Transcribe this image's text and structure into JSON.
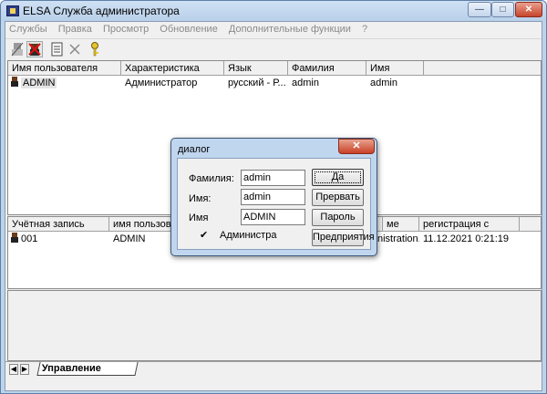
{
  "window": {
    "title": "ELSA Служба администратора",
    "min": "—",
    "max": "□",
    "close": "✕"
  },
  "menu": [
    "Службы",
    "Правка",
    "Просмотр",
    "Обновление",
    "Дополнительные функции",
    "?"
  ],
  "toolbar": {
    "icons": [
      "users-icon",
      "delete-user-icon",
      "properties-icon",
      "close-icon",
      "key-icon"
    ]
  },
  "top_table": {
    "columns": [
      "Имя пользователя",
      "Характеристика",
      "Язык",
      "Фамилия",
      "Имя"
    ],
    "rows": [
      {
        "user": "ADMIN",
        "characteristic": "Администратор",
        "lang": "русский - Р...",
        "surname": "admin",
        "name": "admin"
      }
    ]
  },
  "bottom_table": {
    "columns": [
      "Учётная запись",
      "имя пользовате",
      "",
      "ме",
      "регистрация с"
    ],
    "rows": [
      {
        "account": "001",
        "username": "ADMIN",
        "extra": "nistration...",
        "reg": "11.12.2021 0:21:19"
      }
    ]
  },
  "tabs": {
    "active": "Управление заказами"
  },
  "dialog": {
    "title": "диалог",
    "close": "✕",
    "surname_label": "Фамилия:",
    "surname_value": "admin",
    "name_label": "Имя:",
    "name_value": "admin",
    "login_label": "Имя",
    "login_value": "ADMIN",
    "admin_checkbox_label": "Администра",
    "admin_checked": true,
    "buttons": {
      "ok": "Да",
      "cancel": "Прервать",
      "password": "Пароль",
      "enterprises": "Предприятия"
    }
  }
}
